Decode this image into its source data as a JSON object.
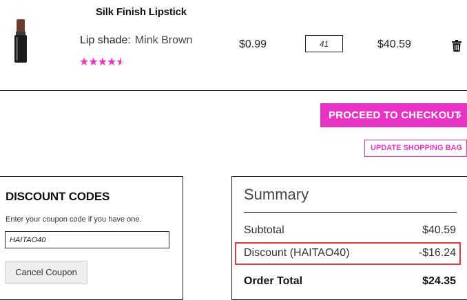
{
  "product": {
    "name": "Silk Finish Lipstick",
    "shade_label": "Lip shade:",
    "shade_value": "Mink Brown",
    "rating": 4.5,
    "price": "$0.99",
    "quantity": "41",
    "subtotal": "$40.59",
    "image_icon": "lipstick-icon",
    "remove_icon": "trash-icon"
  },
  "actions": {
    "checkout_label": "PROCEED TO CHECKOUT",
    "update_label": "UPDATE SHOPPING BAG"
  },
  "discount": {
    "title": "DISCOUNT CODES",
    "help": "Enter your coupon code if you have one.",
    "code_value": "HAITAO40",
    "cancel_label": "Cancel Coupon"
  },
  "summary": {
    "title": "Summary",
    "rows": [
      {
        "label": "Subtotal",
        "value": "$40.59"
      },
      {
        "label": "Discount (HAITAO40)",
        "value": "-$16.24"
      },
      {
        "label": "Order Total",
        "value": "$24.35"
      }
    ]
  },
  "colors": {
    "accent": "#e834c4",
    "highlight": "#e03a3a"
  }
}
